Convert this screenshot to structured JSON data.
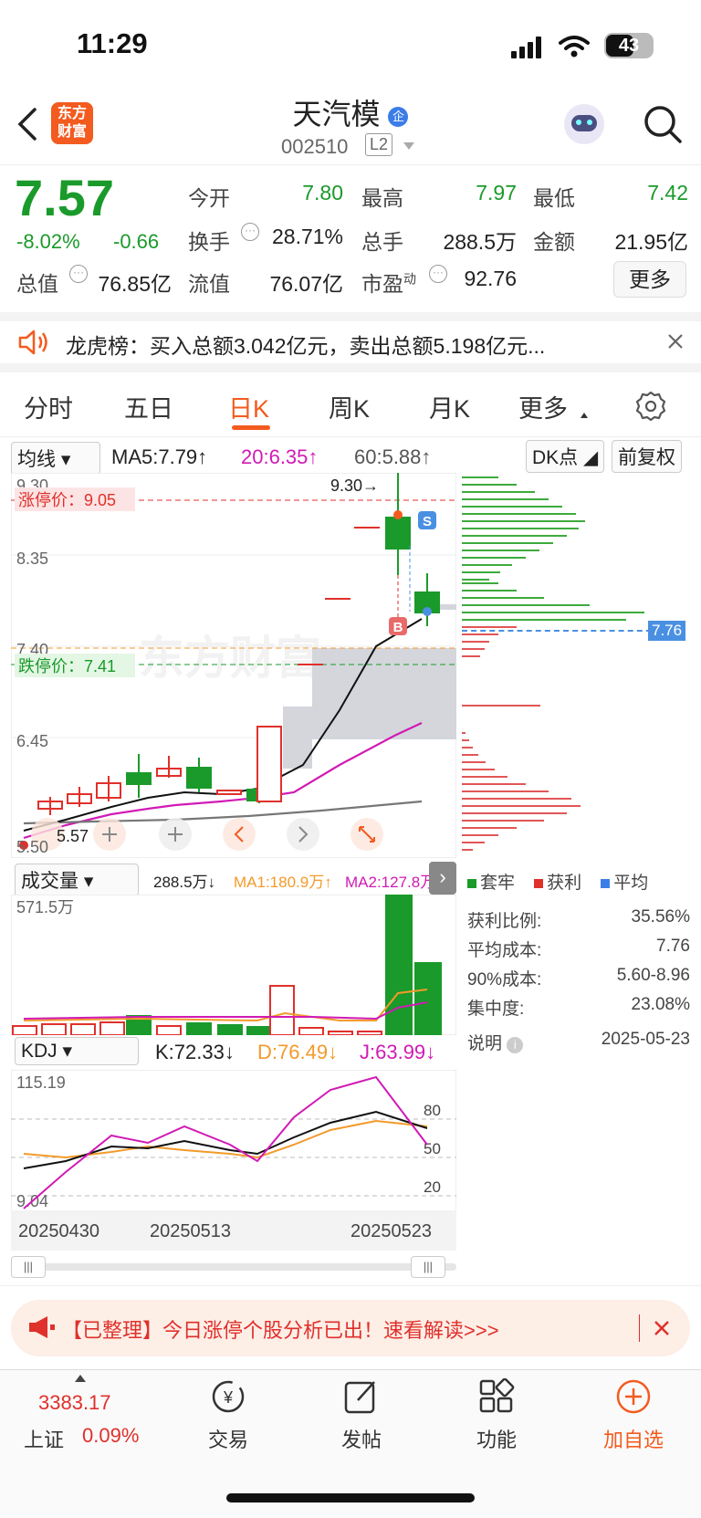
{
  "status": {
    "time": "11:29",
    "battery": "43"
  },
  "header": {
    "logo_line1": "东方",
    "logo_line2": "财富",
    "name": "天汽模",
    "badge": "企",
    "code": "002510",
    "level": "L2"
  },
  "quote": {
    "price": "7.57",
    "pct": "-8.02%",
    "change": "-0.66",
    "open_label": "今开",
    "open": "7.80",
    "high_label": "最高",
    "high": "7.97",
    "low_label": "最低",
    "low": "7.42",
    "turnover_label": "换手",
    "turnover": "28.71%",
    "volume_label": "总手",
    "volume": "288.5万",
    "amount_label": "金额",
    "amount": "21.95亿",
    "mcap_label": "总值",
    "mcap": "76.85亿",
    "float_label": "流值",
    "float": "76.07亿",
    "pe_label": "市盈",
    "pe_sup": "动",
    "pe": "92.76",
    "more": "更多"
  },
  "notice": {
    "text": "龙虎榜：买入总额3.042亿元，卖出总额5.198亿元..."
  },
  "tabs": [
    "分时",
    "五日",
    "日K",
    "周K",
    "月K",
    "更多"
  ],
  "kline": {
    "ma_select": "均线",
    "ma5": "MA5:7.79↑",
    "ma20": "20:6.35↑",
    "ma60": "60:5.88↑",
    "dk_btn": "DK点",
    "adjust_btn": "前复权",
    "y_labels": [
      "9.30",
      "8.35",
      "7.40",
      "6.45",
      "5.50"
    ],
    "limit_up": "涨停价：9.05",
    "limit_down": "跌停价：7.41",
    "max_mark": "9.30→",
    "min_mark": "5.57",
    "s_mark": "S",
    "b_mark": "B"
  },
  "depth": {
    "price_tag": "7.76",
    "legend": [
      "套牢",
      "获利",
      "平均"
    ],
    "stats": [
      {
        "label": "获利比例:",
        "value": "35.56%"
      },
      {
        "label": "平均成本:",
        "value": "7.76"
      },
      {
        "label": "90%成本:",
        "value": "5.60-8.96"
      },
      {
        "label": "集中度:",
        "value": "23.08%"
      }
    ],
    "note": "说明",
    "date": "2025-05-23"
  },
  "volume": {
    "select": "成交量",
    "value": "288.5万↓",
    "ma1": "MA1:180.9万↑",
    "ma2": "MA2:127.8万",
    "max": "571.5万"
  },
  "kdj": {
    "select": "KDJ",
    "k": "K:72.33↓",
    "d": "D:76.49↓",
    "j": "J:63.99↓",
    "max": "115.19",
    "min": "9.04",
    "lines": [
      "80",
      "50",
      "20"
    ]
  },
  "dates": [
    "20250430",
    "20250513",
    "20250523"
  ],
  "banner": {
    "text": "【已整理】今日涨停个股分析已出！速看解读>>>"
  },
  "bottom": {
    "index_value": "3383.17",
    "index_name": "上证",
    "index_pct": "0.09%",
    "items": [
      "交易",
      "发帖",
      "功能",
      "加自选"
    ]
  },
  "colors": {
    "up": "#e0302b",
    "down": "#1a9a2a",
    "accent": "#f35b1f"
  },
  "chart_data": {
    "type": "candlestick",
    "x": [
      "20250430",
      "20250513",
      "20250523"
    ],
    "ylim": [
      5.5,
      9.3
    ],
    "last_close": 7.57,
    "ma": {
      "MA5": 7.79,
      "MA20": 6.35,
      "MA60": 5.88
    },
    "limit_up": 9.05,
    "limit_down": 7.41,
    "volume": {
      "last": "288.5万",
      "max": "571.5万"
    },
    "kdj": {
      "K": 72.33,
      "D": 76.49,
      "J": 63.99,
      "ylim": [
        9.04,
        115.19
      ]
    }
  }
}
